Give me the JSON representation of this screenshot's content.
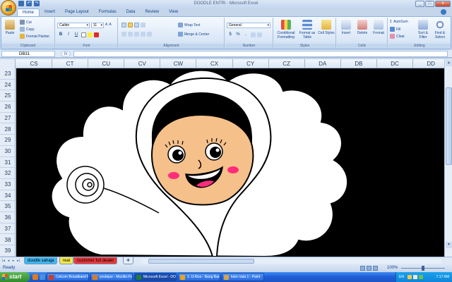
{
  "window": {
    "title": "DOODLE ENTRI - Microsoft Excel",
    "controls": [
      "_",
      "□",
      "x"
    ]
  },
  "ribbon": {
    "tabs": [
      "Home",
      "Insert",
      "Page Layout",
      "Formulas",
      "Data",
      "Review",
      "View"
    ],
    "active_tab": "Home",
    "clipboard": {
      "label": "Clipboard",
      "paste": "Paste",
      "cut": "Cut",
      "copy": "Copy",
      "format_painter": "Format Painter"
    },
    "font": {
      "label": "Font",
      "name": "Calibri",
      "size": "11",
      "bold": "B",
      "italic": "I",
      "underline": "U",
      "grow": "A",
      "shrink": "A"
    },
    "alignment": {
      "label": "Alignment",
      "wrap": "Wrap Text",
      "merge": "Merge & Center"
    },
    "number": {
      "label": "Number",
      "format": "General",
      "currency": "$",
      "percent": "%",
      "comma": ","
    },
    "styles": {
      "label": "Styles",
      "conditional": "Conditional Formatting",
      "format_table": "Format as Table",
      "cell_styles": "Cell Styles"
    },
    "cells": {
      "label": "Cells",
      "insert": "Insert",
      "delete": "Delete",
      "format": "Format"
    },
    "editing": {
      "label": "Editing",
      "autosum": "AutoSum",
      "fill": "Fill",
      "clear": "Clear",
      "sort": "Sort & Filter",
      "find": "Find & Select"
    }
  },
  "formula_bar": {
    "name_box": "DB31",
    "fx": "fx",
    "value": ""
  },
  "grid": {
    "columns": [
      "CS",
      "CT",
      "CU",
      "CV",
      "CW",
      "CX",
      "CY",
      "CZ",
      "DA",
      "DB",
      "DC",
      "DD"
    ],
    "rows": [
      "23",
      "24",
      "25",
      "26",
      "27",
      "28",
      "29",
      "30",
      "31",
      "32",
      "33",
      "34",
      "35",
      "36",
      "37",
      "38",
      "39"
    ]
  },
  "sheet_tabs": [
    {
      "label": "doodle sahaja",
      "color": "#3fb6f0"
    },
    {
      "label": "real",
      "color": "#f4e64a"
    },
    {
      "label": "customer full dealer",
      "color": "#e8373a"
    }
  ],
  "status": {
    "ready": "Ready",
    "zoom": "100%",
    "zoom_level": 0.5
  },
  "taskbar": {
    "start": "start",
    "tasks": [
      {
        "label": "Celcom Broadband M...",
        "icon_color": "#d23a2a"
      },
      {
        "label": "youtique - Mozilla Fir...",
        "icon_color": "#e07a1e"
      },
      {
        "label": "Microsoft Excel - DO...",
        "icon_color": "#1f7d3a"
      },
      {
        "label": "1. U-Kiss - Bang Bang...",
        "icon_color": "#e8a51c"
      },
      {
        "label": "tutor nata 1 - Paint",
        "icon_color": "#d8a44a"
      }
    ],
    "active_task": 2,
    "language": "EN",
    "clock": "7:17 AM"
  },
  "colors": {
    "sheet_background": "#000000",
    "cloud": "#ffffff",
    "skin": "#f5c08a",
    "hijab_inner": "#000000",
    "cheeks": "#ff2d7a"
  }
}
